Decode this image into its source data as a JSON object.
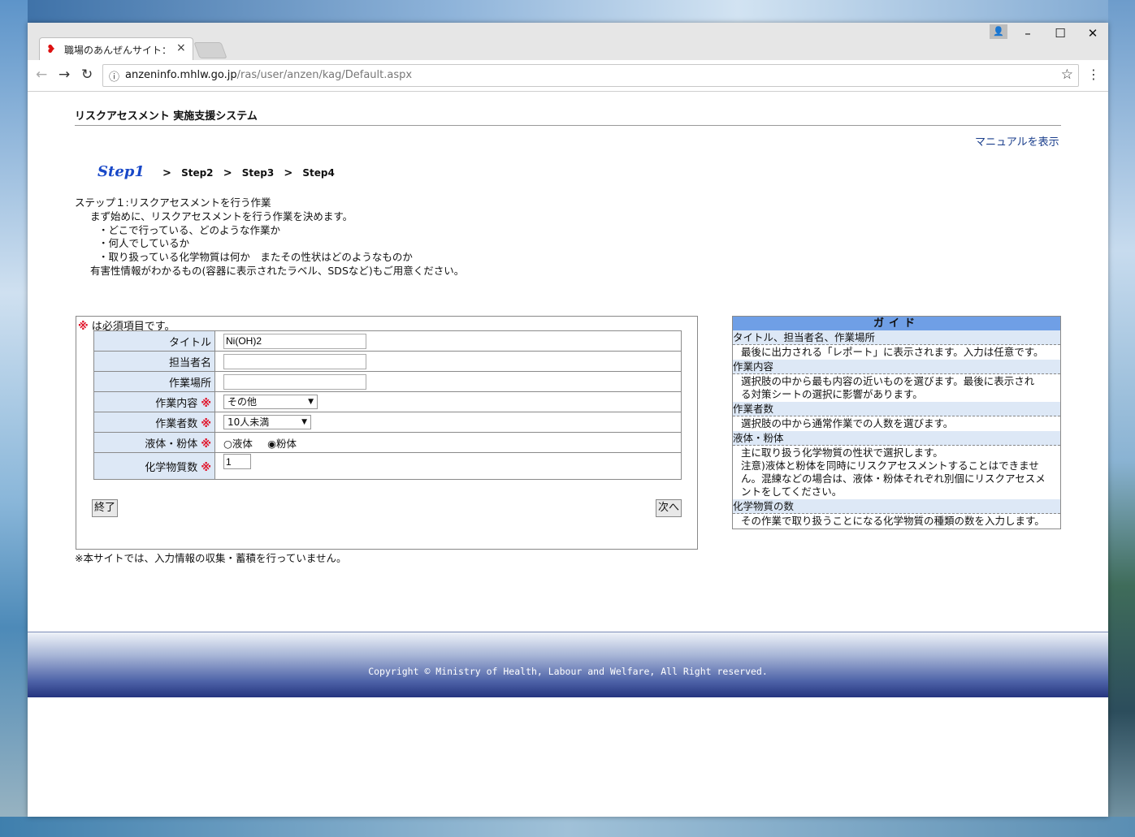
{
  "browser": {
    "tab_title": "職場のあんぜんサイト：化学",
    "url_host": "anzeninfo.mhlw.go.jp",
    "url_path": "/ras/user/anzen/kag/Default.aspx"
  },
  "header": {
    "system_title": "リスクアセスメント 実施支援システム",
    "manual_link": "マニュアルを表示"
  },
  "steps": {
    "current": "Step1",
    "others": [
      "Step2",
      "Step3",
      "Step4"
    ],
    "separator": ">"
  },
  "intro": {
    "heading": "ステップ１:リスクアセスメントを行う作業",
    "lines": [
      "まず始めに、リスクアセスメントを行う作業を決めます。",
      "・どこで行っている、どのような作業か",
      "・何人でしているか",
      "・取り扱っている化学物質は何か　またその性状はどのようなものか",
      "有害性情報がわかるもの(容器に表示されたラベル、SDSなど)もご用意ください。"
    ]
  },
  "form": {
    "required_mark": "※",
    "required_note": "は必須項目です。",
    "fields": {
      "title": {
        "label": "タイトル",
        "value": "Ni(OH)2"
      },
      "person": {
        "label": "担当者名",
        "value": ""
      },
      "place": {
        "label": "作業場所",
        "value": ""
      },
      "work": {
        "label": "作業内容",
        "selected": "その他"
      },
      "workers": {
        "label": "作業者数",
        "selected": "10人未満"
      },
      "state": {
        "label": "液体・粉体",
        "options": [
          "液体",
          "粉体"
        ],
        "selected": "粉体"
      },
      "chem_count": {
        "label": "化学物質数",
        "value": "1"
      }
    },
    "finish_button": "終了",
    "next_button": "次へ",
    "footnote": "※本サイトでは、入力情報の収集・蓄積を行っていません。"
  },
  "guide": {
    "heading": "ガイド",
    "items": [
      {
        "term": "タイトル、担当者名、作業場所",
        "desc": [
          "最後に出力される「レポート」に表示されます。入力は任意です。"
        ]
      },
      {
        "term": "作業内容",
        "desc": [
          "選択肢の中から最も内容の近いものを選びます。最後に表示され",
          "る対策シートの選択に影響があります。"
        ]
      },
      {
        "term": "作業者数",
        "desc": [
          "選択肢の中から通常作業での人数を選びます。"
        ]
      },
      {
        "term": "液体・粉体",
        "desc": [
          "主に取り扱う化学物質の性状で選択します。",
          "注意)液体と粉体を同時にリスクアセスメントすることはできませ",
          "ん。混練などの場合は、液体・粉体それぞれ別個にリスクアセスメ",
          "ントをしてください。"
        ]
      },
      {
        "term": "化学物質の数",
        "desc": [
          "その作業で取り扱うことになる化学物質の種類の数を入力します。"
        ]
      }
    ]
  },
  "footer": {
    "copyright": "Copyright © Ministry of Health, Labour and Welfare, All Right reserved."
  }
}
